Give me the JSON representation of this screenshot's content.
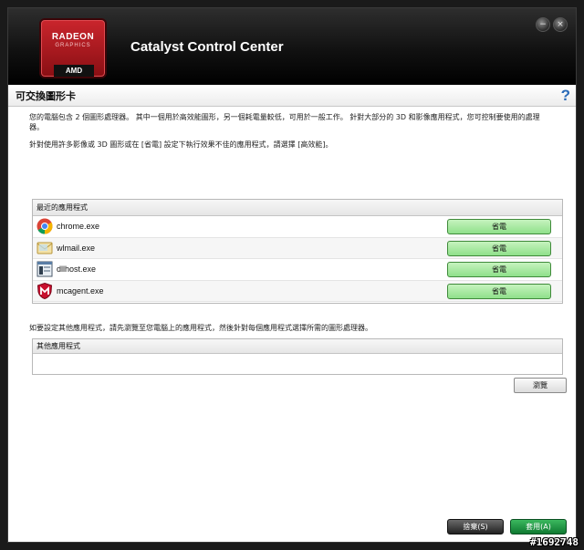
{
  "logo": {
    "line1": "RADEON",
    "line2": "GRAPHICS",
    "brand": "AMD"
  },
  "titlebar": {
    "title": "Catalyst Control Center",
    "minimize_glyph": "−",
    "close_glyph": "×"
  },
  "header": {
    "title": "可交換圖形卡",
    "help_glyph": "?"
  },
  "description": {
    "para1_line1": "您的電腦包含 2 個圖形處理器。 其中一個用於高效能圖形，另一個耗電量較低，可用於一般工作。 針對大部分的 3D 和影像應用程式，您可控制要使用的處理",
    "para1_line2": "器。",
    "para2": "針對使用許多影像或 3D 圖形或在 [省電] 設定下執行效果不佳的應用程式，請選擇 [高效能]。"
  },
  "recent_apps": {
    "header": "最近的應用程式",
    "items": [
      {
        "name": "chrome.exe",
        "mode": "省電",
        "icon": "chrome-icon"
      },
      {
        "name": "wlmail.exe",
        "mode": "省電",
        "icon": "windows-live-mail-icon"
      },
      {
        "name": "dllhost.exe",
        "mode": "省電",
        "icon": "dllhost-icon"
      },
      {
        "name": "mcagent.exe",
        "mode": "省電",
        "icon": "mcafee-icon"
      }
    ]
  },
  "other_apps": {
    "instructions": "如要設定其他應用程式，請先瀏覽至您電腦上的應用程式，然後針對每個應用程式選擇所需的圖形處理器。",
    "header": "其他應用程式",
    "browse_label": "瀏覽"
  },
  "footer": {
    "discard_label": "捨棄(S)",
    "apply_label": "套用(A)"
  },
  "watermark": "#1692748",
  "colors": {
    "accent_green": "#8fe08a",
    "title_bar": "#111111",
    "amd_red": "#c9252c",
    "help_blue": "#2a6bb8"
  }
}
